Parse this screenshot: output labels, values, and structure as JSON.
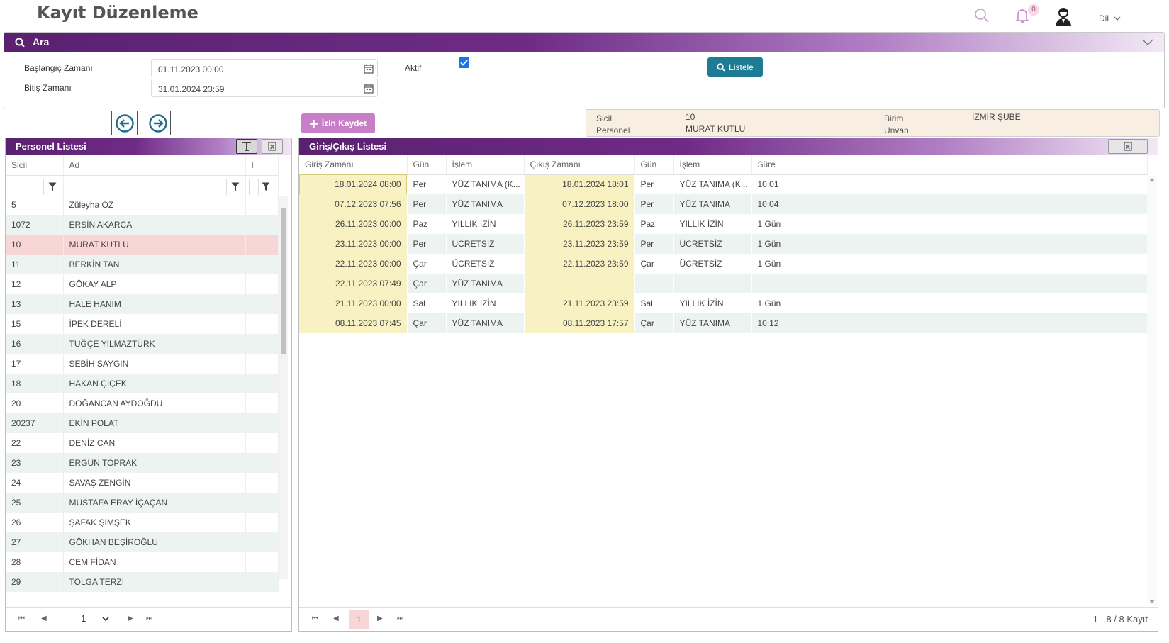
{
  "header": {
    "title": "Kayıt Düzenleme",
    "notification_count": "0",
    "language_label": "Dil"
  },
  "search": {
    "title": "Ara",
    "start_label": "Başlangıç Zamanı",
    "start_value": "01.11.2023 00:00",
    "end_label": "Bitiş Zamanı",
    "end_value": "31.01.2024 23:59",
    "active_label": "Aktif",
    "active_checked": true,
    "list_button": "Listele"
  },
  "actions": {
    "izin_button": "İzin Kaydet"
  },
  "info": {
    "sicil_label": "Sicil",
    "sicil_value": "10",
    "personel_label": "Personel",
    "personel_value": "MURAT KUTLU",
    "birim_label": "Birim",
    "birim_value": "İZMİR ŞUBE",
    "unvan_label": "Unvan"
  },
  "personel_list": {
    "title": "Personel Listesi",
    "columns": [
      "Sicil",
      "Ad",
      "I"
    ],
    "rows": [
      [
        "5",
        "Züleyha ÖZ"
      ],
      [
        "1072",
        "ERSİN AKARCA"
      ],
      [
        "10",
        "MURAT KUTLU"
      ],
      [
        "11",
        "BERKİN TAN"
      ],
      [
        "12",
        "GÖKAY ALP"
      ],
      [
        "13",
        "HALE HANIM"
      ],
      [
        "15",
        "İPEK DERELİ"
      ],
      [
        "16",
        "TUĞÇE YILMAZTÜRK"
      ],
      [
        "17",
        "SEBİH SAYGIN"
      ],
      [
        "18",
        "HAKAN ÇİÇEK"
      ],
      [
        "20",
        "DOĞANCAN AYDOĞDU"
      ],
      [
        "20237",
        "EKİN POLAT"
      ],
      [
        "22",
        "DENİZ CAN"
      ],
      [
        "23",
        "ERGÜN TOPRAK"
      ],
      [
        "24",
        "SAVAŞ ZENGİN"
      ],
      [
        "25",
        "MUSTAFA ERAY İÇAÇAN"
      ],
      [
        "26",
        "ŞAFAK ŞİMŞEK"
      ],
      [
        "27",
        "GÖKHAN BEŞİROĞLU"
      ],
      [
        "28",
        "CEM FİDAN"
      ],
      [
        "29",
        "TOLGA TERZİ"
      ]
    ],
    "selected_index": 2,
    "page": "1"
  },
  "giris_list": {
    "title": "Giriş/Çıkış Listesi",
    "columns": [
      "Giriş Zamanı",
      "Gün",
      "İşlem",
      "Çıkış Zamanı",
      "Gün",
      "İşlem",
      "Süre"
    ],
    "rows": [
      [
        "18.01.2024 08:00",
        "Per",
        "YÜZ TANIMA (K...",
        "18.01.2024 18:01",
        "Per",
        "YÜZ TANIMA (K...",
        "10:01",
        "normal"
      ],
      [
        "07.12.2023 07:56",
        "Per",
        "YÜZ TANIMA",
        "07.12.2023 18:00",
        "Per",
        "YÜZ TANIMA",
        "10:04",
        "normal"
      ],
      [
        "26.11.2023 00:00",
        "Paz",
        "YILLIK İZİN",
        "26.11.2023 23:59",
        "Paz",
        "YILLIK İZİN",
        "1 Gün",
        "sunday"
      ],
      [
        "23.11.2023 00:00",
        "Per",
        "ÜCRETSİZ",
        "23.11.2023 23:59",
        "Per",
        "ÜCRETSİZ",
        "1 Gün",
        "leave"
      ],
      [
        "22.11.2023 00:00",
        "Çar",
        "ÜCRETSİZ",
        "22.11.2023 23:59",
        "Çar",
        "ÜCRETSİZ",
        "1 Gün",
        "leave"
      ],
      [
        "22.11.2023 07:49",
        "Çar",
        "YÜZ TANIMA",
        "",
        "",
        "",
        "",
        "normal"
      ],
      [
        "21.11.2023 00:00",
        "Sal",
        "YILLIK İZİN",
        "21.11.2023 23:59",
        "Sal",
        "YILLIK İZİN",
        "1 Gün",
        "leave"
      ],
      [
        "08.11.2023 07:45",
        "Çar",
        "YÜZ TANIMA",
        "08.11.2023 17:57",
        "Çar",
        "YÜZ TANIMA",
        "10:12",
        "normal"
      ]
    ],
    "page": "1",
    "summary": "1 - 8 / 8 Kayıt"
  },
  "colors": {
    "header_purple": "#5a2170",
    "listele_button": "#1f7a94",
    "izin_button": "#c77fc8",
    "selected_row": "#f8d6d6",
    "highlight_cell": "#f8f2c2",
    "leave_text": "#1f8c3a",
    "sunday_text": "#c0392b"
  }
}
